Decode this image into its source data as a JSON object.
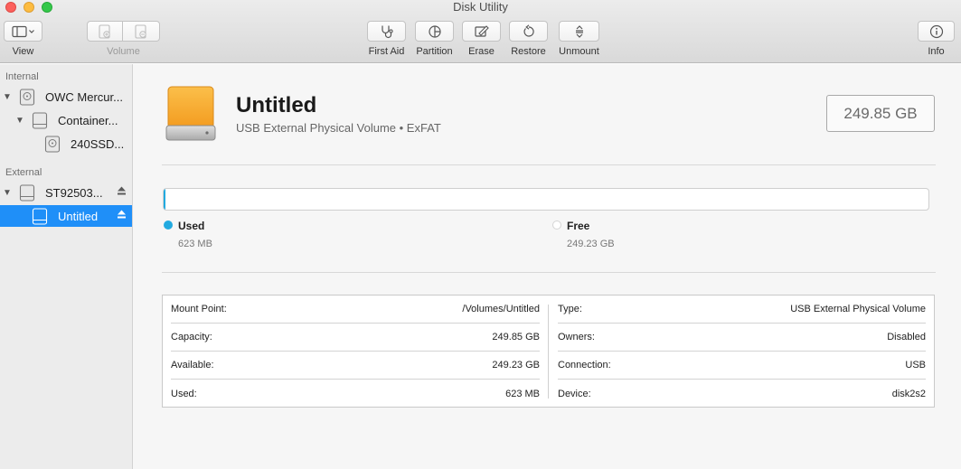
{
  "window": {
    "title": "Disk Utility"
  },
  "toolbar": {
    "view_label": "View",
    "volume_label": "Volume",
    "first_aid_label": "First Aid",
    "partition_label": "Partition",
    "erase_label": "Erase",
    "restore_label": "Restore",
    "unmount_label": "Unmount",
    "info_label": "Info"
  },
  "sidebar": {
    "internal_header": "Internal",
    "external_header": "External",
    "items": [
      {
        "label": "OWC Mercur..."
      },
      {
        "label": "Container..."
      },
      {
        "label": "240SSD..."
      },
      {
        "label": "ST92503..."
      },
      {
        "label": "Untitled",
        "selected": true
      }
    ]
  },
  "volume": {
    "name": "Untitled",
    "subtitle": "USB External Physical Volume • ExFAT",
    "size": "249.85 GB"
  },
  "usage": {
    "used_fraction": 0.0025,
    "used_label": "Used",
    "used_value": "623 MB",
    "free_label": "Free",
    "free_value": "249.23 GB"
  },
  "info": {
    "left": [
      {
        "key": "Mount Point:",
        "value": "/Volumes/Untitled"
      },
      {
        "key": "Capacity:",
        "value": "249.85 GB"
      },
      {
        "key": "Available:",
        "value": "249.23 GB"
      },
      {
        "key": "Used:",
        "value": "623 MB"
      }
    ],
    "right": [
      {
        "key": "Type:",
        "value": "USB External Physical Volume"
      },
      {
        "key": "Owners:",
        "value": "Disabled"
      },
      {
        "key": "Connection:",
        "value": "USB"
      },
      {
        "key": "Device:",
        "value": "disk2s2"
      }
    ]
  },
  "colors": {
    "selection": "#1f8ff8",
    "used": "#22aae0",
    "free": "#ffffff"
  }
}
